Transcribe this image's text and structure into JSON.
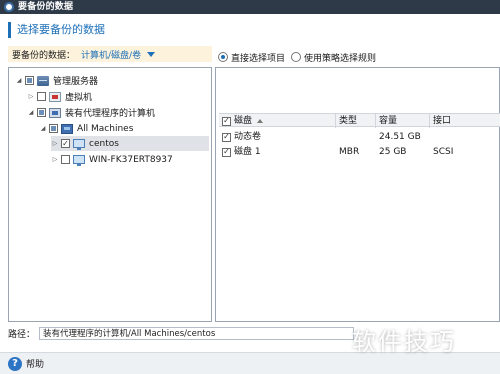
{
  "window": {
    "title": "要备份的数据"
  },
  "heading": "选择要备份的数据",
  "data_type": {
    "label": "要备份的数据：",
    "value": "计算机/磁盘/卷"
  },
  "tree": {
    "items": [
      {
        "label": "管理服务器",
        "icon": "server-icon",
        "check": "partial",
        "expander": "open"
      },
      {
        "label": "虚拟机",
        "icon": "vm-icon",
        "check": "none",
        "expander": "closed"
      },
      {
        "label": "装有代理程序的计算机",
        "icon": "agent-computer-icon",
        "check": "partial",
        "expander": "open"
      },
      {
        "label": "All Machines",
        "icon": "machine-group-icon",
        "check": "partial",
        "expander": "open"
      },
      {
        "label": "centos",
        "icon": "computer-icon",
        "check": "checked",
        "expander": "closed",
        "selected": true
      },
      {
        "label": "WIN-FK37ERT8937",
        "icon": "computer-icon",
        "check": "none",
        "expander": "closed"
      }
    ]
  },
  "selection_mode": {
    "options": [
      {
        "label": "直接选择项目",
        "selected": true
      },
      {
        "label": "使用策略选择规则",
        "selected": false
      }
    ]
  },
  "disk_table": {
    "columns": [
      "磁盘",
      "类型",
      "容量",
      "接口"
    ],
    "rows": [
      {
        "name": "动态卷",
        "type": "",
        "capacity": "24.51 GB",
        "interface": "",
        "checked": true
      },
      {
        "name": "磁盘 1",
        "type": "MBR",
        "capacity": "25 GB",
        "interface": "SCSI",
        "checked": true
      }
    ]
  },
  "path": {
    "label": "路径：",
    "value": "装有代理程序的计算机/All Machines/centos"
  },
  "help": {
    "label": "帮助"
  },
  "watermark": "软件技巧",
  "colors": {
    "accent": "#1d6fb8",
    "titlebar": "#2f3a48",
    "selector_bg": "#fdf3dc"
  }
}
